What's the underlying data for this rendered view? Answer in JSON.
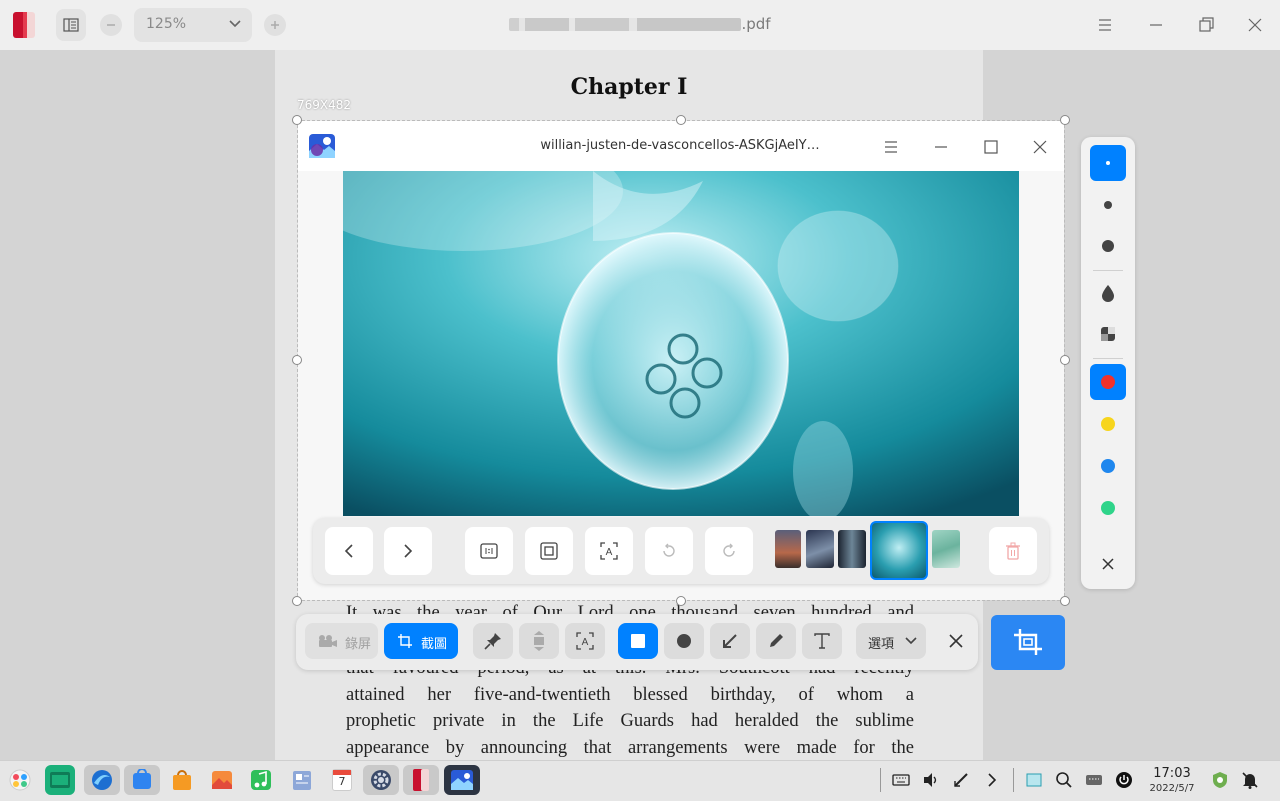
{
  "reader": {
    "zoom_value": "125%",
    "file_suffix": ".pdf",
    "chapter_title": "Chapter I",
    "paragraph_lines": [
      "It was the year of Our Lord one thousand seven hundred and",
      "that favoured period, as at this. Mrs. Southcott had recently",
      "attained her five-and-twentieth blessed birthday, of whom a",
      "prophetic private in the Life Guards had heralded the sublime",
      "appearance by announcing that arrangements were made for the"
    ]
  },
  "screenshot": {
    "selection_size": "769X482"
  },
  "viewer": {
    "title": "willian-justen-de-vasconcellos-ASKGjAeIY…"
  },
  "capture_toolbar": {
    "record_label": "錄屏",
    "screenshot_label": "截圖",
    "options_label": "選項"
  },
  "style_panel": {
    "colors": [
      "#f0312c",
      "#f7d51d",
      "#1f87ee",
      "#2fd48a"
    ],
    "accent": "#0081ff"
  },
  "taskbar": {
    "time": "17:03",
    "date": "2022/5/7",
    "calendar_day": "7"
  }
}
